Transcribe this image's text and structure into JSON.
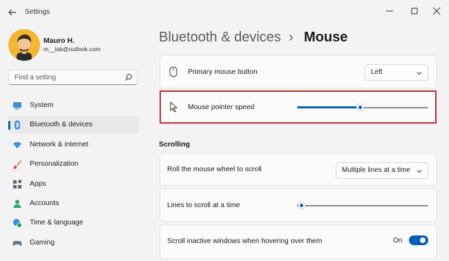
{
  "window": {
    "title": "Settings"
  },
  "profile": {
    "name": "Mauro H.",
    "email": "m__lab@outlook.com"
  },
  "search": {
    "placeholder": "Find a setting"
  },
  "sidebar": {
    "items": [
      {
        "label": "System",
        "icon": "system-icon",
        "selected": false
      },
      {
        "label": "Bluetooth & devices",
        "icon": "bluetooth-icon",
        "selected": true
      },
      {
        "label": "Network & internet",
        "icon": "wifi-icon",
        "selected": false
      },
      {
        "label": "Personalization",
        "icon": "brush-icon",
        "selected": false
      },
      {
        "label": "Apps",
        "icon": "apps-icon",
        "selected": false
      },
      {
        "label": "Accounts",
        "icon": "accounts-icon",
        "selected": false
      },
      {
        "label": "Time & language",
        "icon": "globe-clock-icon",
        "selected": false
      },
      {
        "label": "Gaming",
        "icon": "gamepad-icon",
        "selected": false
      }
    ]
  },
  "header": {
    "parent": "Bluetooth & devices",
    "separator": "›",
    "title": "Mouse"
  },
  "settings": {
    "primary_button": {
      "label": "Primary mouse button",
      "value": "Left"
    },
    "pointer_speed": {
      "label": "Mouse pointer speed",
      "level": 0.48
    },
    "scrolling_header": "Scrolling",
    "roll_wheel": {
      "label": "Roll the mouse wheel to scroll",
      "value": "Multiple lines at a time"
    },
    "lines_to_scroll": {
      "label": "Lines to scroll at a time",
      "level": 0.03
    },
    "inactive_scroll": {
      "label": "Scroll inactive windows when hovering over them",
      "state": "On",
      "enabled": true
    }
  },
  "colors": {
    "accent": "#005fb8",
    "highlight": "#c62828"
  }
}
